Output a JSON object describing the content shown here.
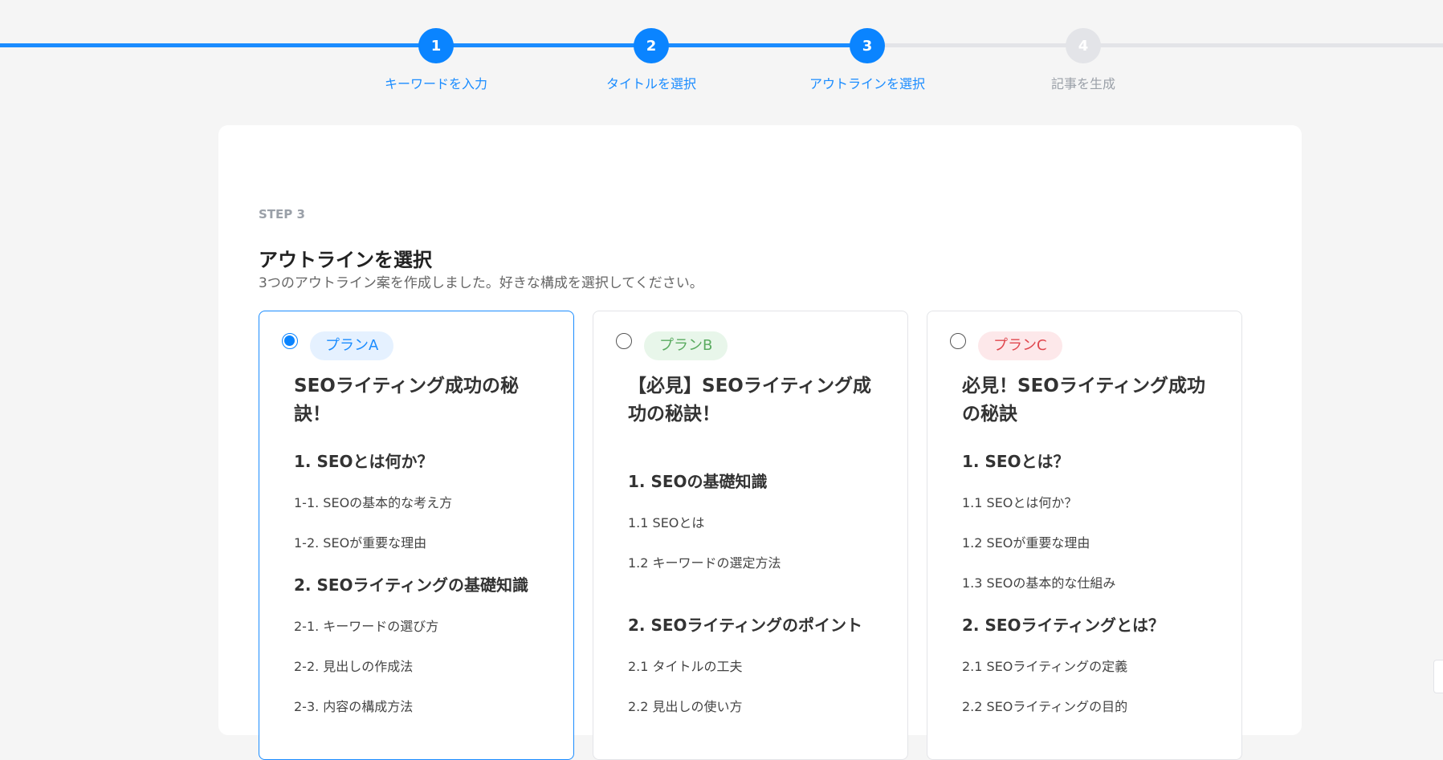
{
  "stepper": {
    "steps": [
      {
        "number": "1",
        "label": "キーワードを入力"
      },
      {
        "number": "2",
        "label": "タイトルを選択"
      },
      {
        "number": "3",
        "label": "アウトラインを選択"
      },
      {
        "number": "4",
        "label": "記事を生成"
      }
    ],
    "current_step": 3
  },
  "page": {
    "step_tag": "STEP 3",
    "title": "アウトラインを選択",
    "subtitle": "3つのアウトライン案を作成しました。好きな構成を選択してください。"
  },
  "plans": [
    {
      "badge": "プランA",
      "selected": true,
      "title": "SEOライティング成功の秘訣！",
      "items": [
        {
          "level": "h",
          "text": "1. SEOとは何か？"
        },
        {
          "level": "s",
          "text": "1-1. SEOの基本的な考え方"
        },
        {
          "level": "s",
          "text": "1-2. SEOが重要な理由"
        },
        {
          "level": "h",
          "text": "2. SEOライティングの基礎知識"
        },
        {
          "level": "s",
          "text": "2-1. キーワードの選び方"
        },
        {
          "level": "s",
          "text": "2-2. 見出しの作成法"
        },
        {
          "level": "s",
          "text": "2-3. 内容の構成方法"
        }
      ]
    },
    {
      "badge": "プランB",
      "selected": false,
      "title": "【必見】SEOライティング成功の秘訣！",
      "items": [
        {
          "level": "h",
          "text": "1. SEOの基礎知識"
        },
        {
          "level": "s",
          "text": "1.1 SEOとは"
        },
        {
          "level": "s",
          "text": "1.2 キーワードの選定方法"
        },
        {
          "level": "h",
          "text": "2. SEOライティングのポイント"
        },
        {
          "level": "s",
          "text": "2.1 タイトルの工夫"
        },
        {
          "level": "s",
          "text": "2.2 見出しの使い方"
        }
      ]
    },
    {
      "badge": "プランC",
      "selected": false,
      "title": "必見！SEOライティング成功の秘訣",
      "items": [
        {
          "level": "h",
          "text": "1. SEOとは？"
        },
        {
          "level": "s",
          "text": "1.1 SEOとは何か？"
        },
        {
          "level": "s",
          "text": "1.2 SEOが重要な理由"
        },
        {
          "level": "s",
          "text": "1.3 SEOの基本的な仕組み"
        },
        {
          "level": "h",
          "text": "2. SEOライティングとは？"
        },
        {
          "level": "s",
          "text": "2.1 SEOライティングの定義"
        },
        {
          "level": "s",
          "text": "2.2 SEOライティングの目的"
        }
      ]
    }
  ]
}
